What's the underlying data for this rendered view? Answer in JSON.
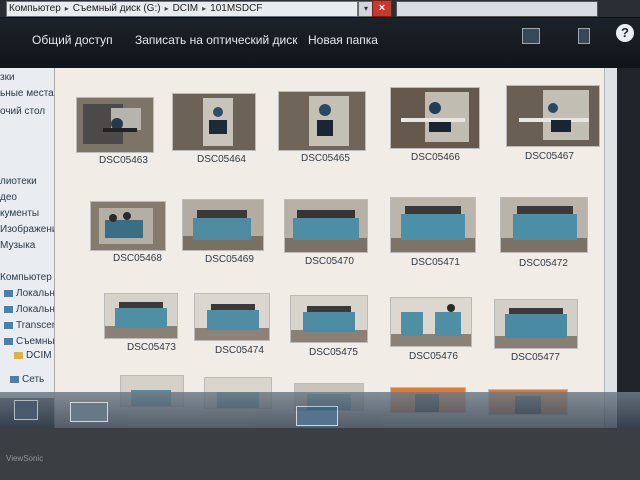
{
  "address": {
    "crumbs": [
      "Компьютер",
      "Съемный диск (G:)",
      "DCIM",
      "101MSDCF"
    ],
    "close_label": "×"
  },
  "toolbar": {
    "share": "Общий доступ",
    "burn": "Записать на оптический диск",
    "new_folder": "Новая папка",
    "help": "?"
  },
  "nav": {
    "items": [
      "зки",
      "ьные места",
      "очий стол",
      "лиотеки",
      "део",
      "кументы",
      "Изображения",
      "Музыка",
      "Компьютер",
      "Локальный диск",
      "Локальный диск",
      "Transcend (F:)",
      "Съемный диск",
      "DCIM",
      "Сеть"
    ]
  },
  "files": [
    {
      "name": "DSC05463"
    },
    {
      "name": "DSC05464"
    },
    {
      "name": "DSC05465"
    },
    {
      "name": "DSC05466"
    },
    {
      "name": "DSC05467"
    },
    {
      "name": "DSC05468"
    },
    {
      "name": "DSC05469"
    },
    {
      "name": "DSC05470"
    },
    {
      "name": "DSC05471"
    },
    {
      "name": "DSC05472"
    },
    {
      "name": "DSC05473"
    },
    {
      "name": "DSC05474"
    },
    {
      "name": "DSC05475"
    },
    {
      "name": "DSC05476"
    },
    {
      "name": "DSC05477"
    },
    {
      "name": ""
    },
    {
      "name": ""
    },
    {
      "name": ""
    },
    {
      "name": ""
    },
    {
      "name": ""
    }
  ],
  "taskbar": {
    "bezel_text": "ViewSonic"
  },
  "colors": {
    "window_bg": "#f1ece6",
    "toolbar": "#1c2229",
    "close": "#c43a2f"
  }
}
